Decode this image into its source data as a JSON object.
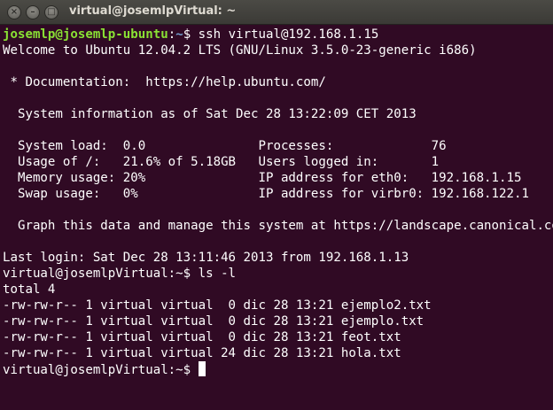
{
  "window": {
    "title": "virtual@josemlpVirtual: ~",
    "buttons": {
      "close": "×",
      "minimize": "–",
      "maximize": "□"
    }
  },
  "terminal": {
    "colors": {
      "background": "#300a24",
      "text": "#ffffff",
      "prompt_user": "#8ae234",
      "prompt_path": "#729fcf"
    },
    "first_prompt": {
      "user_host": "josemlp@josemlp-ubuntu",
      "path": "~",
      "symbol": "$",
      "command": " ssh virtual@192.168.1.15"
    },
    "lines": [
      "Welcome to Ubuntu 12.04.2 LTS (GNU/Linux 3.5.0-23-generic i686)",
      "",
      " * Documentation:  https://help.ubuntu.com/",
      "",
      "  System information as of Sat Dec 28 13:22:09 CET 2013",
      "",
      "  System load:  0.0               Processes:             76",
      "  Usage of /:   21.6% of 5.18GB   Users logged in:       1",
      "  Memory usage: 20%               IP address for eth0:   192.168.1.15",
      "  Swap usage:   0%                IP address for virbr0: 192.168.122.1",
      "",
      "  Graph this data and manage this system at https://landscape.canonical.com/",
      "",
      "Last login: Sat Dec 28 13:11:46 2013 from 192.168.1.13",
      "virtual@josemlpVirtual:~$ ls -l",
      "total 4",
      "-rw-rw-r-- 1 virtual virtual  0 dic 28 13:21 ejemplo2.txt",
      "-rw-rw-r-- 1 virtual virtual  0 dic 28 13:21 ejemplo.txt",
      "-rw-rw-r-- 1 virtual virtual  0 dic 28 13:21 feot.txt",
      "-rw-rw-r-- 1 virtual virtual 24 dic 28 13:21 hola.txt"
    ],
    "current_prompt": "virtual@josemlpVirtual:~$ "
  }
}
